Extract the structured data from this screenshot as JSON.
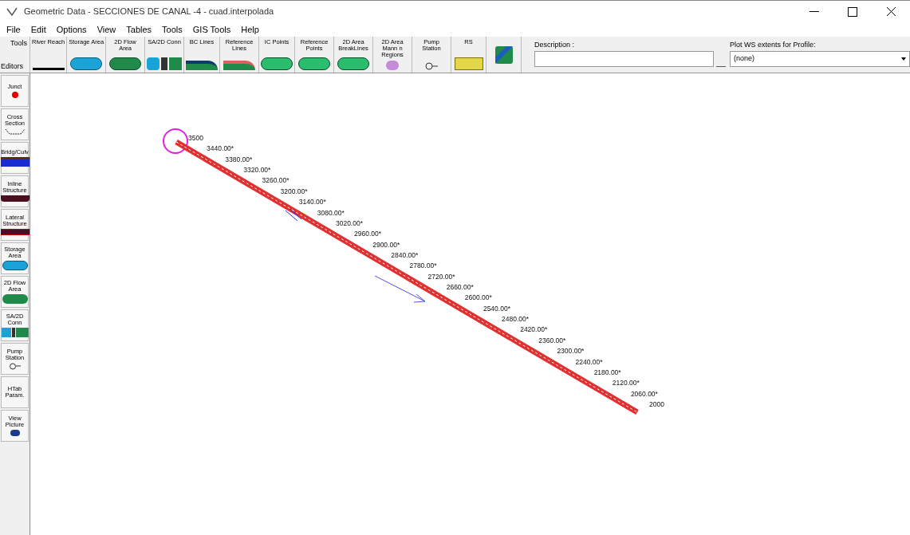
{
  "window": {
    "title": "Geometric Data - SECCIONES DE CANAL -4 - cuad.interpolada"
  },
  "menu": [
    "File",
    "Edit",
    "Options",
    "View",
    "Tables",
    "Tools",
    "GIS Tools",
    "Help"
  ],
  "toolbar": {
    "corner_top": "Tools",
    "corner_bottom": "Editors",
    "buttons": [
      {
        "label": "River Reach",
        "kind": "reach"
      },
      {
        "label": "Storage Area",
        "kind": "storage"
      },
      {
        "label": "2D Flow Area",
        "kind": "flow2d"
      },
      {
        "label": "SA/2D Conn",
        "kind": "conn"
      },
      {
        "label": "BC Lines",
        "kind": "bc"
      },
      {
        "label": "Reference Lines",
        "kind": "reflines"
      },
      {
        "label": "IC Points",
        "kind": "points"
      },
      {
        "label": "Reference Points",
        "kind": "points"
      },
      {
        "label": "2D Area BreakLines",
        "kind": "points"
      },
      {
        "label": "2D Area Mann n Regions",
        "kind": "mann"
      },
      {
        "label": "Pump Station",
        "kind": "pump"
      },
      {
        "label": "RS",
        "kind": "rs"
      },
      {
        "kind": "map"
      }
    ],
    "description": {
      "label": "Description :"
    },
    "plot_ws": {
      "label": "Plot WS extents for Profile:",
      "value": "(none)"
    }
  },
  "editors": [
    {
      "label": "Junct",
      "kind": "junct"
    },
    {
      "label": "Cross Section",
      "kind": "xs"
    },
    {
      "label": "Bridg/Culv",
      "kind": "bridge"
    },
    {
      "label": "Inline Structure",
      "kind": "inline"
    },
    {
      "label": "Lateral Structure",
      "kind": "lateral"
    },
    {
      "label": "Storage Area",
      "kind": "storage"
    },
    {
      "label": "2D Flow Area",
      "kind": "flow2d"
    },
    {
      "label": "SA/2D Conn",
      "kind": "conn"
    },
    {
      "label": "Pump Station",
      "kind": "pump"
    },
    {
      "label": "HTab Param.",
      "kind": "text"
    },
    {
      "label": "View Picture",
      "kind": "picture"
    }
  ],
  "cross_sections": [
    "3500",
    "3440.00*",
    "3380.00*",
    "3320.00*",
    "3260.00*",
    "3200.00*",
    "3140.00*",
    "3080.00*",
    "3020.00*",
    "2960.00*",
    "2900.00*",
    "2840.00*",
    "2780.00*",
    "2720.00*",
    "2660.00*",
    "2600.00*",
    "2540.00*",
    "2480.00*",
    "2420.00*",
    "2360.00*",
    "2300.00*",
    "2240.00*",
    "2180.00*",
    "2120.00*",
    "2060.00*",
    "2000"
  ]
}
